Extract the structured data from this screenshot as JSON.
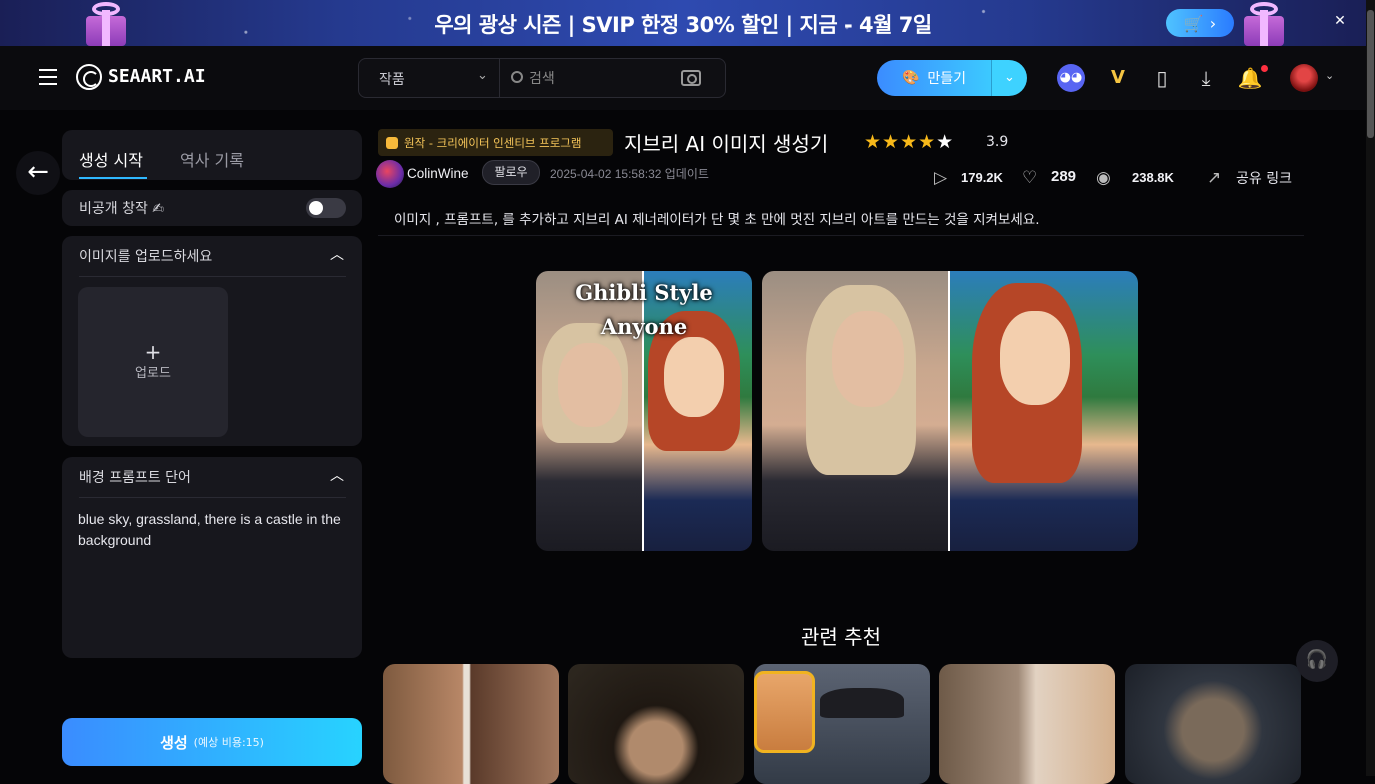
{
  "banner": {
    "text": "우의 광상 시즌 | SVIP 한정 30% 할인 | 지금 - 4월 7일",
    "cart_chevron": "›",
    "close": "✕"
  },
  "header": {
    "logo_text": "SEAART.AI",
    "search_category": "작품",
    "search_placeholder": "검색",
    "create_label": "만들기",
    "create_dropdown": "⌄",
    "vip_label": "V",
    "avatar_chevron": "⌄"
  },
  "left_panel": {
    "back_arrow": "←",
    "tab_start": "생성 시작",
    "tab_history": "역사 기록",
    "private_label": "비공개 창작 ✍",
    "private_toggle": "off",
    "upload_title": "이미지를 업로드하세요",
    "upload_plus": "+",
    "upload_label": "업로드",
    "prompt_title": "배경 프롬프트 단어",
    "prompt_text": "blue sky, grassland, there is a castle in the background",
    "section_chevron": "︿",
    "generate_label": "생성",
    "generate_cost": "(예상 비용:15)"
  },
  "main": {
    "program_badge": "원작 - 크리에이터 인센티브 프로그램",
    "title": "지브리 AI 이미지 생성기",
    "rating_stars": "★★★★",
    "rating_last_star": "★",
    "rating": "3.9",
    "author": "ColinWine",
    "follow": "팔로우",
    "updated": "2025-04-02 15:58:32 업데이트",
    "runs": "179.2K",
    "likes": "289",
    "views": "238.8K",
    "share": "공유 링크",
    "description": "이미지 , 프롬프트, 를 추가하고 지브리 AI 제너레이터가 단 몇 초 만에 멋진 지브리 아트를 만드는 것을 지켜보세요.",
    "hero_caption_line1": "Ghibli Style",
    "hero_caption_line2": "Anyone",
    "related_title": "관련 추천"
  },
  "icons": {
    "play": "▷",
    "heart": "♡",
    "eye": "◉",
    "share": "↗",
    "phone": "▯",
    "download": "⤓",
    "bell": "🔔",
    "headset": "🎧",
    "cart": "🛒",
    "discord": "◕◕"
  },
  "colors": {
    "accent": "#2fb8ff",
    "create_gradient": [
      "#3b8cff",
      "#3cc9ff"
    ],
    "star": "#f8b91a",
    "badge_text": "#f6c65a",
    "notification_dot": "#ff3040"
  }
}
